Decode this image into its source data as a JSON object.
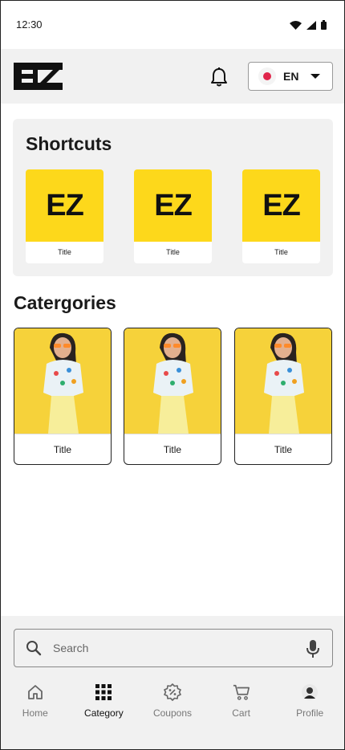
{
  "status_bar": {
    "time": "12:30"
  },
  "header": {
    "logo_text": "EZ",
    "language": "EN"
  },
  "shortcuts": {
    "title": "Shortcuts",
    "items": [
      {
        "logo": "EZ",
        "title": "Title"
      },
      {
        "logo": "EZ",
        "title": "Title"
      },
      {
        "logo": "EZ",
        "title": "Title"
      }
    ]
  },
  "categories": {
    "title": "Catergories",
    "items": [
      {
        "title": "Title"
      },
      {
        "title": "Title"
      },
      {
        "title": "Title"
      }
    ]
  },
  "search": {
    "placeholder": "Search"
  },
  "nav": {
    "items": [
      {
        "label": "Home",
        "icon": "home-icon"
      },
      {
        "label": "Category",
        "icon": "grid-icon"
      },
      {
        "label": "Coupons",
        "icon": "coupon-icon"
      },
      {
        "label": "Cart",
        "icon": "cart-icon"
      },
      {
        "label": "Profile",
        "icon": "avatar-icon"
      }
    ],
    "active": "Category"
  },
  "colors": {
    "accent": "#fdd81b",
    "flag": "#e0264b",
    "header_bg": "#f1f1f1"
  }
}
